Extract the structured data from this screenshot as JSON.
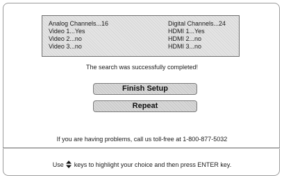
{
  "summary": {
    "left": [
      "Analog Channels...16",
      "Video 1...Yes",
      "Video 2...no",
      "Video 3...no"
    ],
    "right": [
      "Digital Channels...24",
      "HDMI 1...Yes",
      "HDMI 2...no",
      "HDMI 3...no"
    ]
  },
  "message": "The search was successfully completed!",
  "buttons": {
    "finish_label": "Finish Setup",
    "repeat_label": "Repeat"
  },
  "help_text": "If you are having problems, call us toll-free at 1-800-877-5032",
  "footer": {
    "before_icon": "Use",
    "icon": "up-down-arrow-icon",
    "after_icon": "keys to highlight your choice and then press ENTER key."
  }
}
